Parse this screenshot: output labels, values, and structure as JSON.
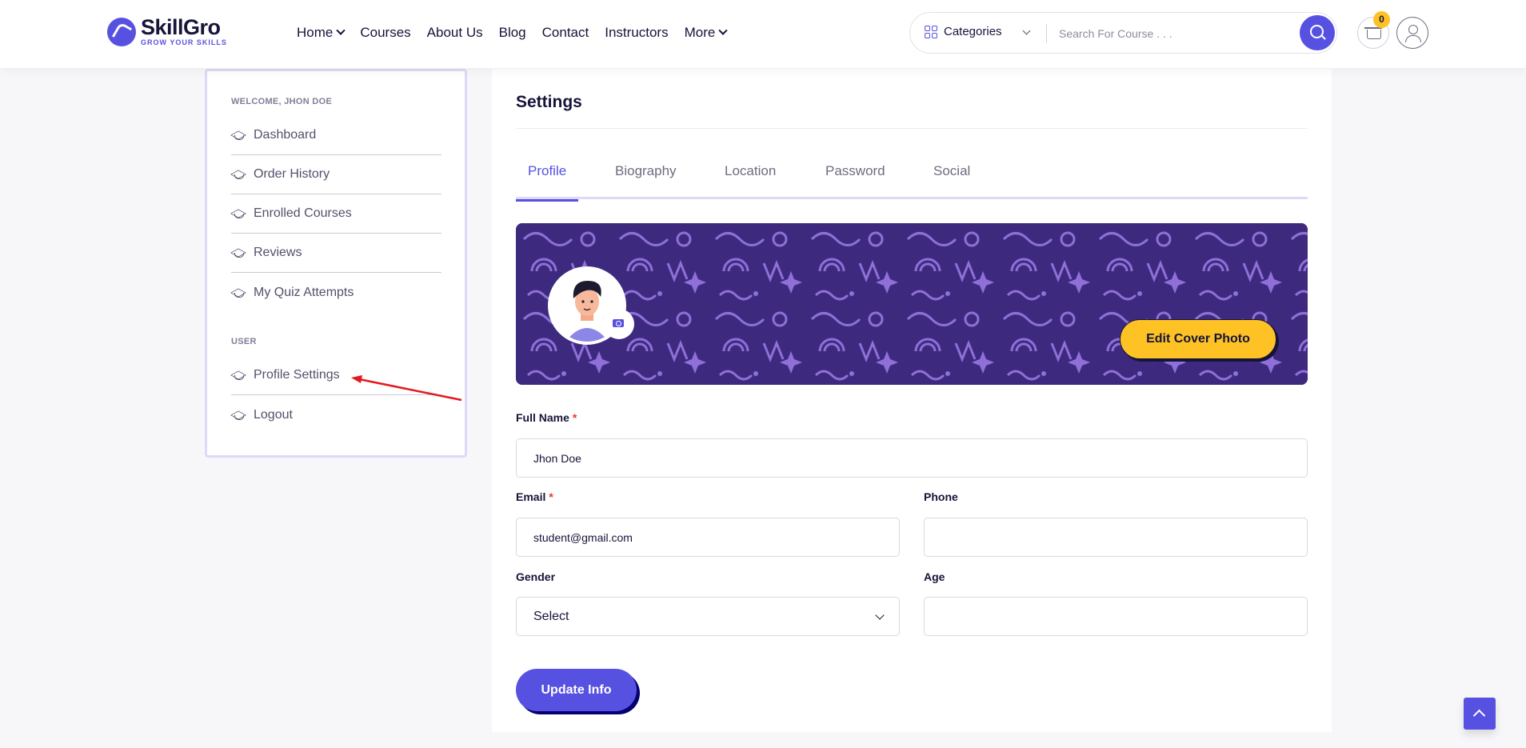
{
  "logo": {
    "name": "SkillGro",
    "tagline": "GROW YOUR SKILLS"
  },
  "nav": [
    {
      "label": "Home",
      "dropdown": true
    },
    {
      "label": "Courses",
      "dropdown": false
    },
    {
      "label": "About Us",
      "dropdown": false
    },
    {
      "label": "Blog",
      "dropdown": false
    },
    {
      "label": "Contact",
      "dropdown": false
    },
    {
      "label": "Instructors",
      "dropdown": false
    },
    {
      "label": "More",
      "dropdown": true
    }
  ],
  "search": {
    "category_label": "Categories",
    "placeholder": "Search For Course . . ."
  },
  "cart": {
    "count": "0"
  },
  "sidebar": {
    "welcome": "WELCOME, JHON DOE",
    "items": [
      {
        "label": "Dashboard"
      },
      {
        "label": "Order History"
      },
      {
        "label": "Enrolled Courses"
      },
      {
        "label": "Reviews"
      },
      {
        "label": "My Quiz Attempts"
      }
    ],
    "user_section": "USER",
    "user_items": [
      {
        "label": "Profile Settings"
      },
      {
        "label": "Logout"
      }
    ]
  },
  "main": {
    "title": "Settings",
    "tabs": [
      {
        "label": "Profile",
        "active": true
      },
      {
        "label": "Biography",
        "active": false
      },
      {
        "label": "Location",
        "active": false
      },
      {
        "label": "Password",
        "active": false
      },
      {
        "label": "Social",
        "active": false
      }
    ],
    "edit_cover_label": "Edit Cover Photo",
    "form": {
      "full_name_label": "Full Name",
      "full_name_value": "Jhon Doe",
      "email_label": "Email",
      "email_value": "student@gmail.com",
      "phone_label": "Phone",
      "phone_value": "",
      "gender_label": "Gender",
      "gender_value": "Select",
      "age_label": "Age",
      "age_value": "",
      "required_mark": "*",
      "submit_label": "Update Info"
    }
  },
  "colors": {
    "accent": "#5751e1",
    "yellow": "#ffc224",
    "cover": "#3d2a7e",
    "annotation_arrow": "#e3191f"
  }
}
